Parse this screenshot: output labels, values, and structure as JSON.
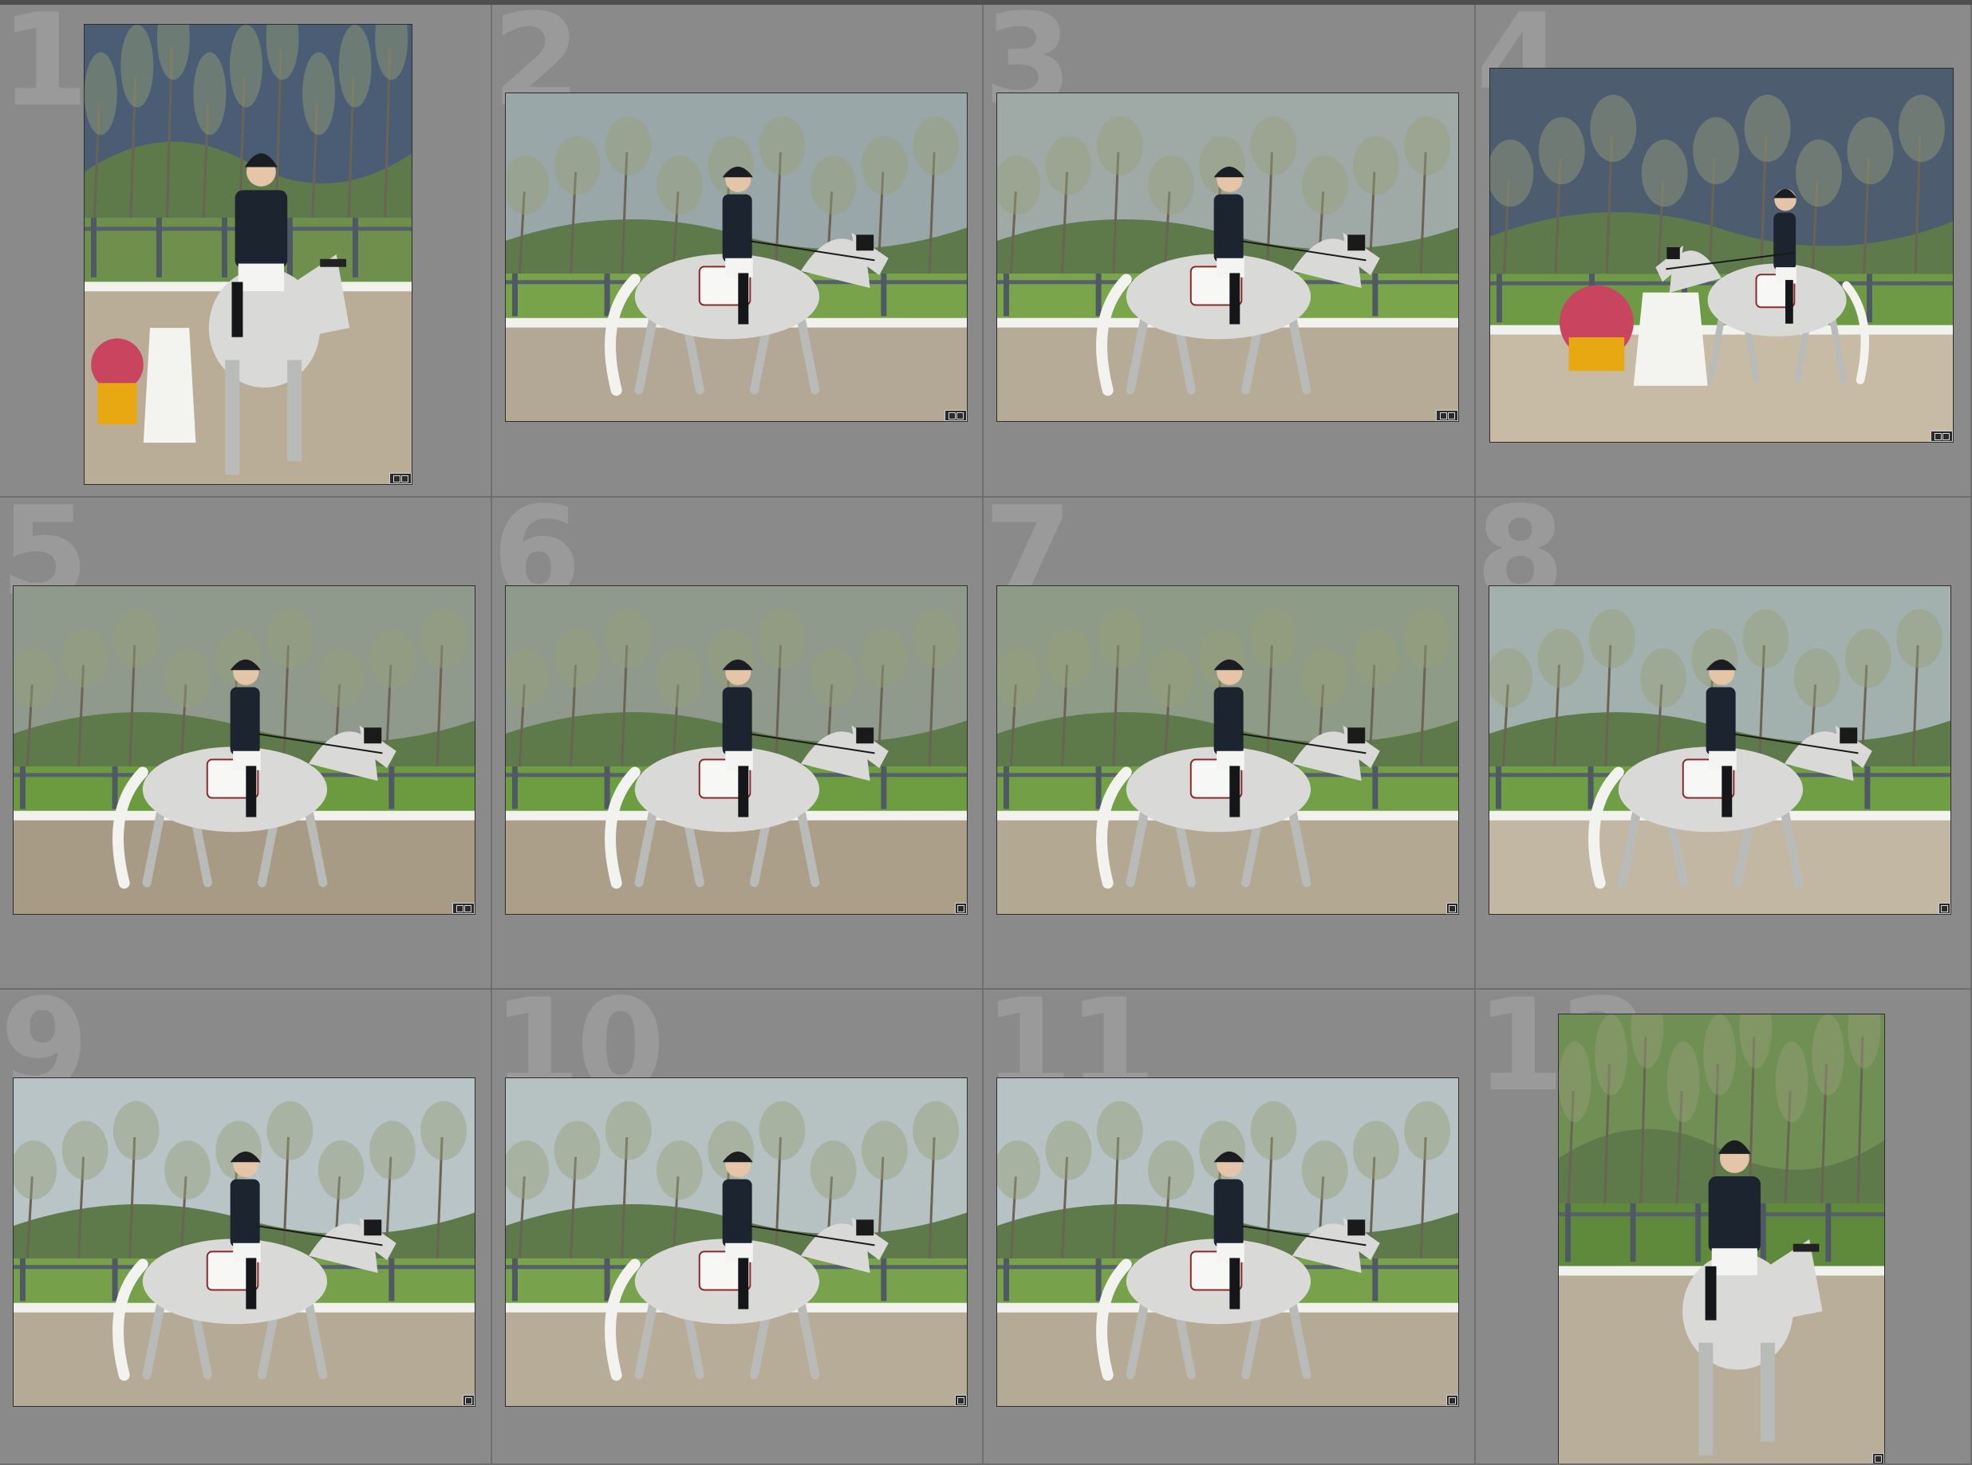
{
  "grid": {
    "columns": 4,
    "rows": 3,
    "cells": [
      {
        "number": "1",
        "orientation": "portrait",
        "scene": "approach",
        "badges": 2,
        "sky": "#4b5d74",
        "ground": "#b9ad98",
        "grass": "#6f8f4d"
      },
      {
        "number": "2",
        "orientation": "landscape",
        "scene": "trot-right",
        "badges": 2,
        "sky": "#9aa7a8",
        "ground": "#b3a895",
        "grass": "#78a34a"
      },
      {
        "number": "3",
        "orientation": "landscape",
        "scene": "trot-right",
        "badges": 2,
        "sky": "#9fa9a6",
        "ground": "#b6ab97",
        "grass": "#7aa54b"
      },
      {
        "number": "4",
        "orientation": "landscape",
        "scene": "trot-left-flowers",
        "badges": 2,
        "sky": "#4d5c6f",
        "ground": "#c7bba6",
        "grass": "#6f9a45"
      },
      {
        "number": "5",
        "orientation": "landscape",
        "scene": "trot-right",
        "badges": 2,
        "sky": "#8f9a8c",
        "ground": "#a79b86",
        "grass": "#6c9a3f"
      },
      {
        "number": "6",
        "orientation": "landscape",
        "scene": "trot-right",
        "badges": 1,
        "sky": "#8f9a8c",
        "ground": "#ab9f8a",
        "grass": "#6e9c41"
      },
      {
        "number": "7",
        "orientation": "landscape",
        "scene": "trot-right",
        "badges": 1,
        "sky": "#8e9b86",
        "ground": "#b3a892",
        "grass": "#73a046"
      },
      {
        "number": "8",
        "orientation": "landscape",
        "scene": "trot-right",
        "badges": 1,
        "sky": "#a3b1ae",
        "ground": "#c2b7a3",
        "grass": "#6f9e45"
      },
      {
        "number": "9",
        "orientation": "landscape",
        "scene": "trot-right",
        "badges": 1,
        "sky": "#b9c4c6",
        "ground": "#b5aa95",
        "grass": "#76a04a"
      },
      {
        "number": "10",
        "orientation": "landscape",
        "scene": "trot-right",
        "badges": 1,
        "sky": "#b6c1c2",
        "ground": "#b7ac97",
        "grass": "#78a24b"
      },
      {
        "number": "11",
        "orientation": "landscape",
        "scene": "trot-right",
        "badges": 1,
        "sky": "#b7c2c4",
        "ground": "#b5aa95",
        "grass": "#77a14a"
      },
      {
        "number": "12",
        "orientation": "portrait",
        "scene": "approach-trees",
        "badges": 1,
        "sky": "#6f8f55",
        "ground": "#b9ae99",
        "grass": "#5f8a3c"
      }
    ]
  }
}
